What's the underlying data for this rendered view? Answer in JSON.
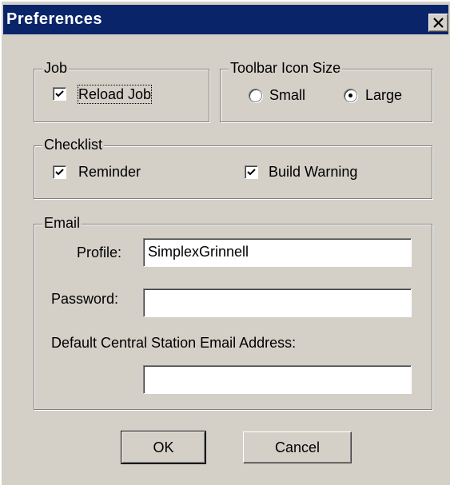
{
  "window": {
    "title": "Preferences"
  },
  "job": {
    "legend": "Job",
    "reload_job_label": "Reload Job",
    "reload_job_checked": true
  },
  "toolbar_icon_size": {
    "legend": "Toolbar Icon Size",
    "options": [
      {
        "label": "Small",
        "selected": false
      },
      {
        "label": "Large",
        "selected": true
      }
    ]
  },
  "checklist": {
    "legend": "Checklist",
    "reminder_label": "Reminder",
    "reminder_checked": true,
    "build_warning_label": "Build Warning",
    "build_warning_checked": true
  },
  "email": {
    "legend": "Email",
    "profile_label": "Profile:",
    "profile_value": "SimplexGrinnell",
    "password_label": "Password:",
    "password_value": "",
    "default_address_label": "Default Central Station Email Address:",
    "default_address_value": ""
  },
  "buttons": {
    "ok_label": "OK",
    "cancel_label": "Cancel"
  }
}
